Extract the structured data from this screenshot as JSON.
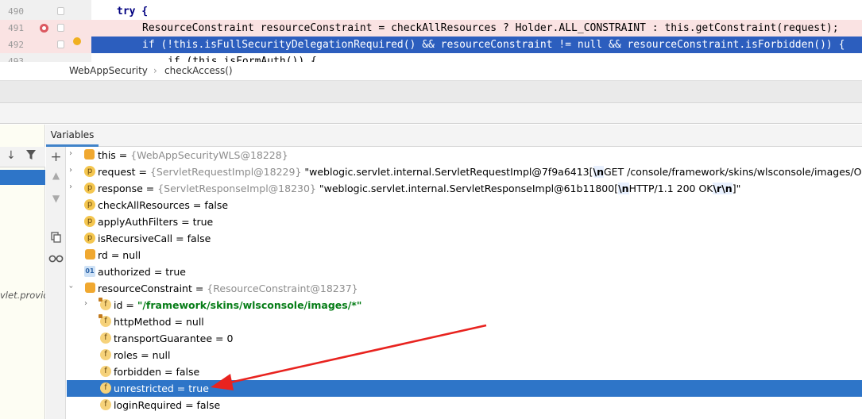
{
  "editor": {
    "lines": [
      {
        "number": "490",
        "code": "try {"
      },
      {
        "number": "491",
        "code": "ResourceConstraint resourceConstraint = checkAllResources ? Holder.ALL_CONSTRAINT : this.getConstraint(request);"
      },
      {
        "number": "492",
        "code": "if (!this.isFullSecurityDelegationRequired() && resourceConstraint != null && resourceConstraint.isForbidden()) {"
      },
      {
        "number": "493",
        "code": "if (this.isFormAuth()) {"
      }
    ]
  },
  "breadcrumb": {
    "class_name": "WebAppSecurity",
    "separator": "›",
    "method_name": "checkAccess()"
  },
  "frames": {
    "partial_frame_text": "vlet.provid"
  },
  "variables_panel": {
    "tab_label": "Variables",
    "rows": [
      {
        "name": "this",
        "value": "{WebAppSecurityWLS@18228}"
      },
      {
        "name": "request",
        "type": "{ServletRequestImpl@18229}",
        "value_pre": "\"weblogic.servlet.internal.ServletRequestImpl@7f9a6413[",
        "esc": "\\n",
        "value_post": "GET /console/framework/skins/wlsconsole/images/OracleLogo.png"
      },
      {
        "name": "response",
        "type": "{ServletResponseImpl@18230}",
        "value_pre": "\"weblogic.servlet.internal.ServletResponseImpl@61b11800[",
        "esc": "\\n",
        "value_mid": "HTTP/1.1 200 OK",
        "esc2": "\\r",
        "esc3": "\\n",
        "value_post": "]\""
      },
      {
        "name": "checkAllResources",
        "value": "false"
      },
      {
        "name": "applyAuthFilters",
        "value": "true"
      },
      {
        "name": "isRecursiveCall",
        "value": "false"
      },
      {
        "name": "rd",
        "value": "null"
      },
      {
        "name": "authorized",
        "value": "true",
        "badge": "01"
      },
      {
        "name": "resourceConstraint",
        "type": "{ResourceConstraint@18237}"
      },
      {
        "name": "id",
        "value": "\"/framework/skins/wlsconsole/images/*\""
      },
      {
        "name": "httpMethod",
        "value": "null"
      },
      {
        "name": "transportGuarantee",
        "value": "0"
      },
      {
        "name": "roles",
        "value": "null"
      },
      {
        "name": "forbidden",
        "value": "false"
      },
      {
        "name": "unrestricted",
        "value": "true"
      },
      {
        "name": "loginRequired",
        "value": "false"
      }
    ],
    "eq": " = "
  },
  "colors": {
    "selection": "#2e75c8",
    "execution_line": "#2c5ebe",
    "breakpoint_line": "#fae3e3",
    "annotation_arrow": "#e8231f"
  }
}
